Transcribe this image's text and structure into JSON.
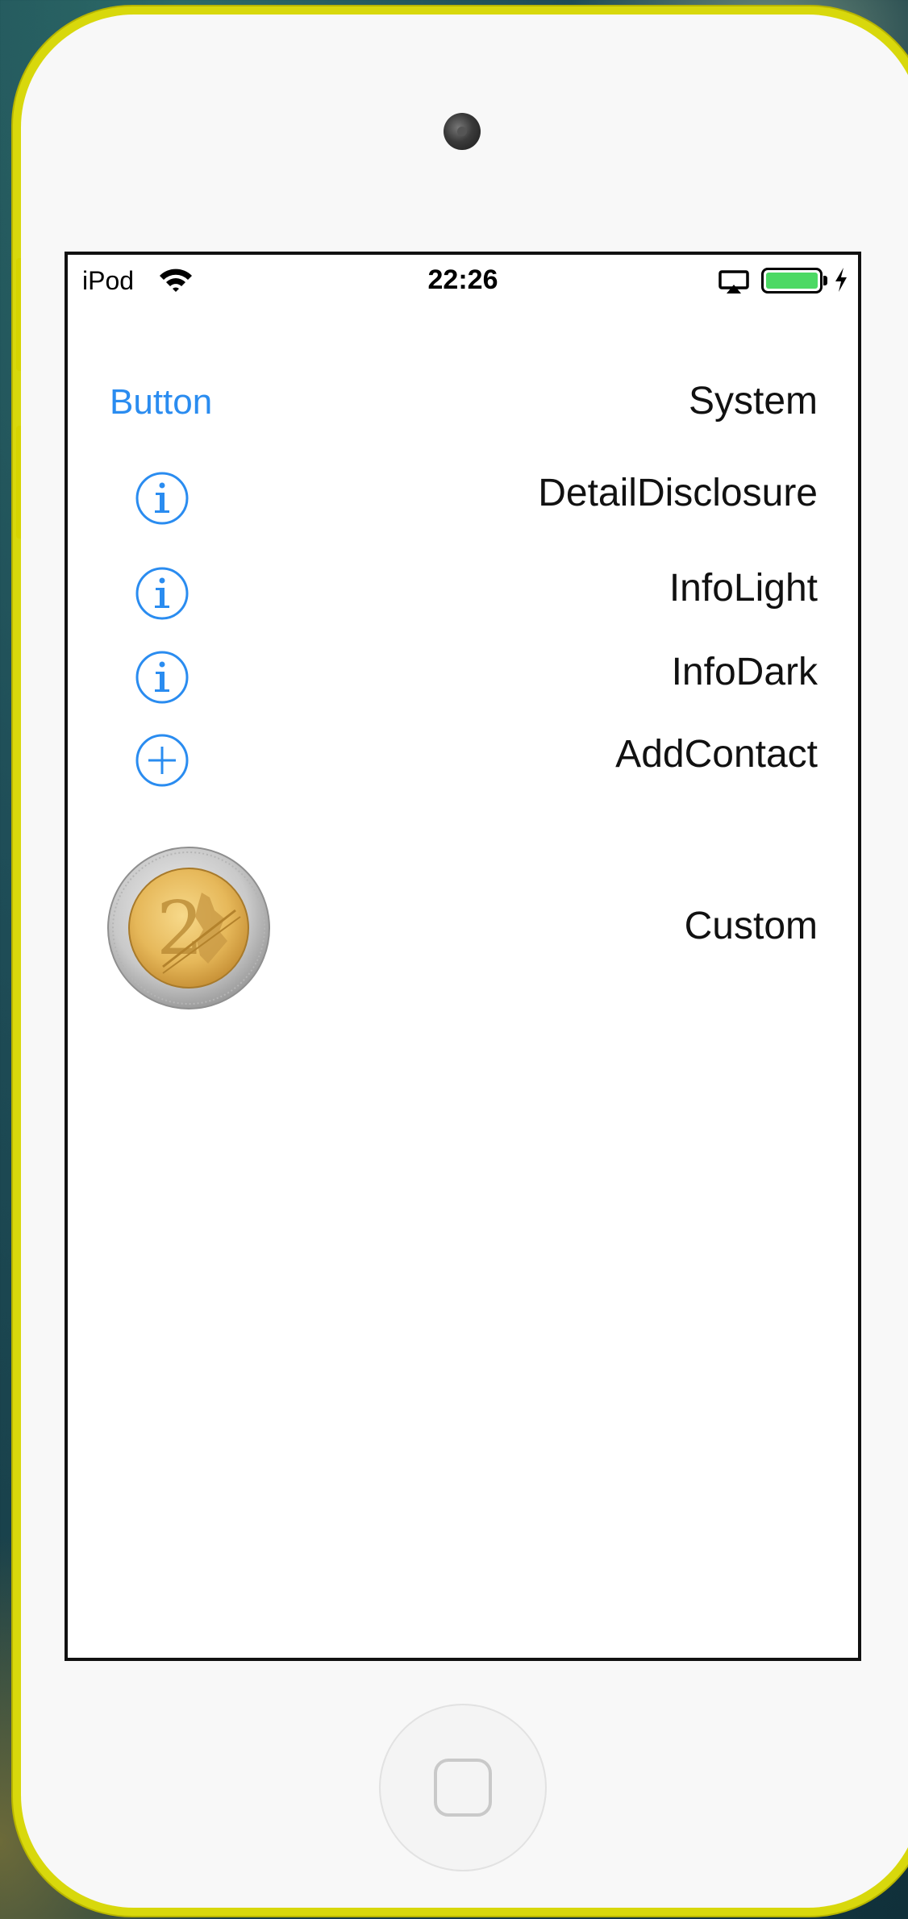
{
  "status_bar": {
    "carrier": "iPod",
    "time": "22:26",
    "battery_level": 1.0,
    "charging": true,
    "wifi_icon": "wifi-icon",
    "airplay_icon": "airplay-icon"
  },
  "colors": {
    "accent": "#2a8cf0",
    "device_frame": "#d8d80c",
    "battery": "#4cd964"
  },
  "rows": {
    "system": {
      "button_label": "Button",
      "label": "System"
    },
    "detail_disclosure": {
      "icon": "info-icon",
      "label": "DetailDisclosure"
    },
    "info_light": {
      "icon": "info-icon",
      "label": "InfoLight"
    },
    "info_dark": {
      "icon": "info-icon",
      "label": "InfoDark"
    },
    "add_contact": {
      "icon": "plus-circle-icon",
      "label": "AddContact"
    },
    "custom": {
      "icon": "two-euro-coin-icon",
      "label": "Custom"
    }
  }
}
